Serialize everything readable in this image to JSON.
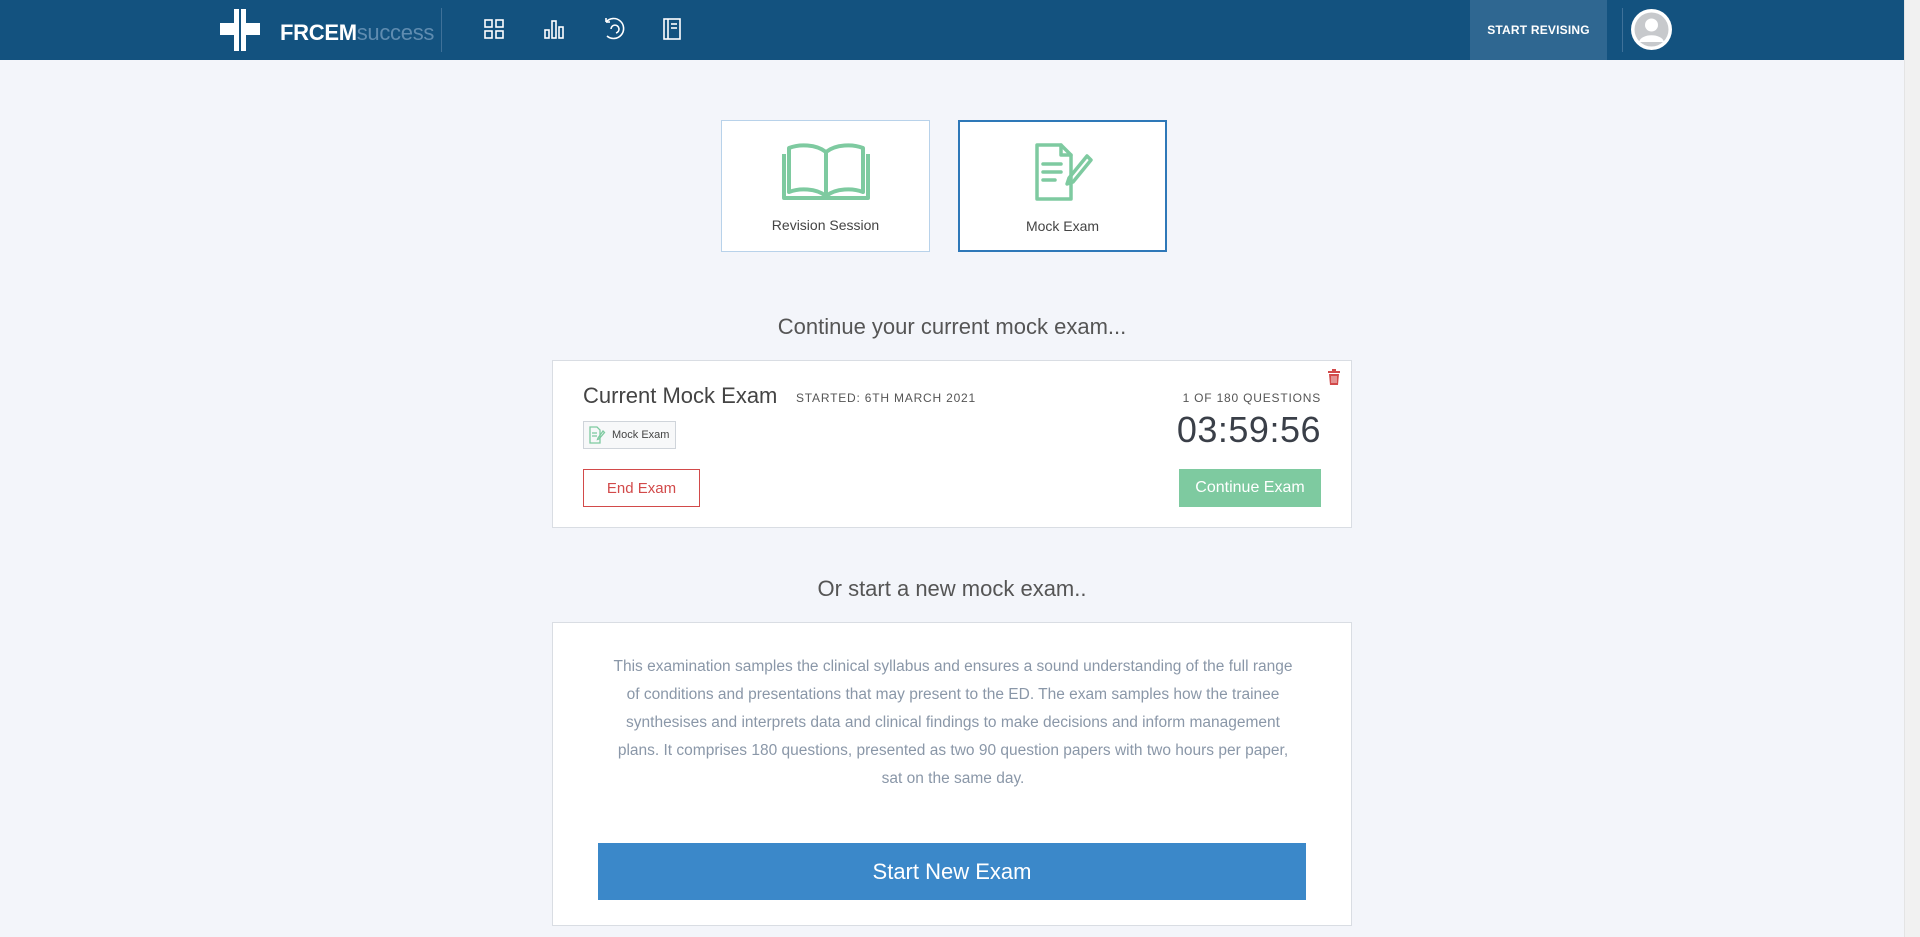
{
  "header": {
    "brand_bold": "FRCEM",
    "brand_light": "success",
    "nav_icons": [
      "dashboard-grid-icon",
      "bar-chart-icon",
      "history-icon",
      "book-icon"
    ],
    "start_revising_label": "START REVISING",
    "colors": {
      "bar": "#13527f",
      "accent_button": "#2f6791"
    }
  },
  "modes": {
    "revision_label": "Revision Session",
    "mock_label": "Mock Exam",
    "selected": "Mock Exam",
    "icon_color": "#7ecaa0"
  },
  "current": {
    "heading": "Continue your current mock exam...",
    "title": "Current Mock Exam",
    "started": "STARTED: 6TH MARCH 2021",
    "tag": "Mock Exam",
    "questions": "1 OF 180 QUESTIONS",
    "timer": "03:59:56",
    "end_label": "End Exam",
    "continue_label": "Continue Exam"
  },
  "new_exam": {
    "heading": "Or start a new mock exam..",
    "description": "This examination samples the clinical syllabus and ensures a sound understanding of the full range of conditions and presentations that may present to the ED. The exam samples how the trainee synthesises and interprets data and clinical findings to make decisions and inform management plans. It comprises 180 questions, presented as two 90 question papers with two hours per paper, sat on the same day.",
    "start_label": "Start New Exam"
  }
}
